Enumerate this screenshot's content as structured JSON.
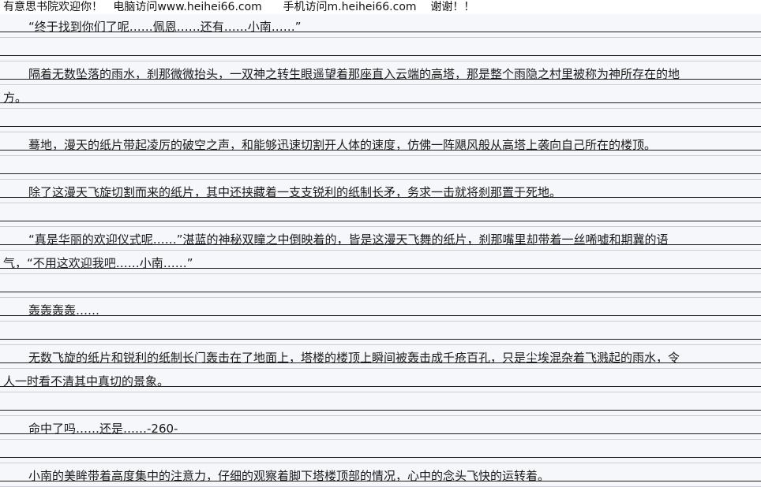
{
  "banner": {
    "site_name": "有意思书院欢迎你！",
    "pc_access": "电脑访问www.heihei66.com",
    "mobile_access": "手机访问m.heihei66.com",
    "thanks": "谢谢！！"
  },
  "document": {
    "lines": [
      "“终于找到你们了呢……佩恩……还有……小南……”",
      "隔着无数坠落的雨水，刹那微微抬头，一双神之转生眼遥望着那座直入云端的高塔，那是整个雨隐之村里被称为神所存在的地",
      "方。",
      "蓦地，漫天的纸片带起凌厉的破空之声，和能够迅速切割开人体的速度，仿佛一阵飓风般从高塔上袭向自己所在的楼顶。",
      "除了这漫天飞旋切割而来的纸片，其中还挟藏着一支支锐利的纸制长矛，务求一击就将刹那置于死地。",
      "“真是华丽的欢迎仪式呢……”湛蓝的神秘双瞳之中倒映着的，皆是这漫天飞舞的纸片，刹那嘴里却带着一丝唏嘘和期冀的语",
      "气，“不用这欢迎我吧……小南……”",
      "轰轰轰轰……",
      "无数飞旋的纸片和锐利的纸制长门轰击在了地面上，塔楼的楼顶上瞬间被轰击成千疮百孔，只是尘埃混杂着飞溅起的雨水，令",
      "人一时看不清其中真切的景象。",
      "命中了吗……还是……-260-",
      "小南的美眸带着高度集中的注意力，仔细的观察着脚下塔楼顶部的情况，心中的念头飞快的运转着。"
    ]
  }
}
